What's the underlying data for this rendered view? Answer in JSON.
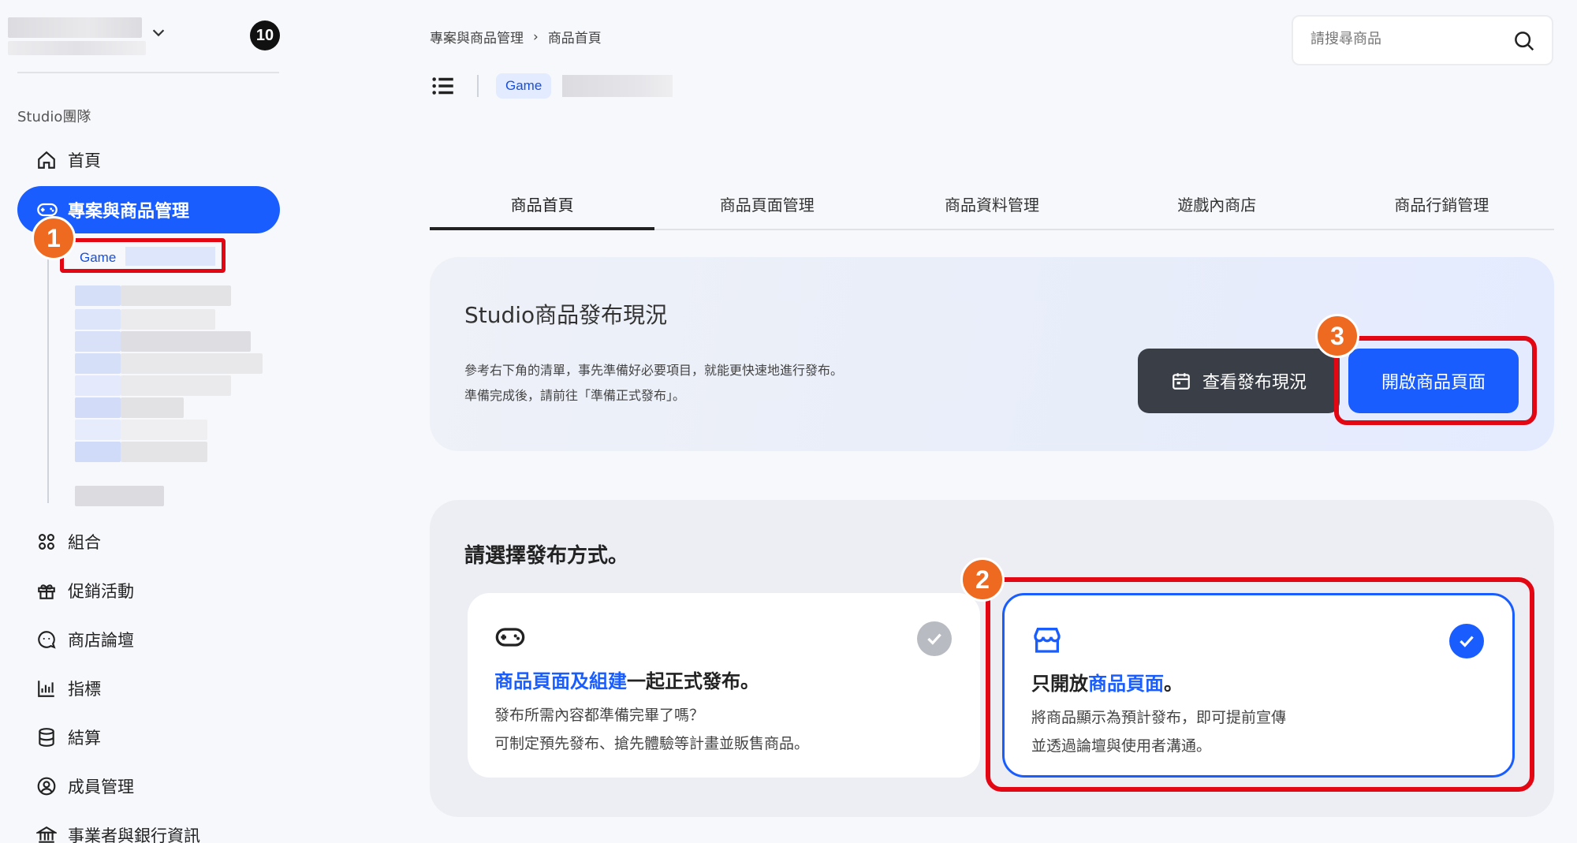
{
  "sidebar": {
    "notification_count": "10",
    "team_label": "Studio團隊",
    "home": "首頁",
    "active_item": "專案與商品管理",
    "game_label": "Game",
    "items": [
      "組合",
      "促銷活動",
      "商店論壇",
      "指標",
      "結算",
      "成員管理",
      "事業者與銀行資訊"
    ]
  },
  "breadcrumb": {
    "parent": "專案與商品管理",
    "separator": "›",
    "current": "商品首頁"
  },
  "search": {
    "placeholder": "請搜尋商品"
  },
  "header": {
    "chip": "Game"
  },
  "tabs": [
    "商品首頁",
    "商品頁面管理",
    "商品資料管理",
    "遊戲內商店",
    "商品行銷管理"
  ],
  "status_panel": {
    "title": "Studio商品發布現況",
    "desc_line1": "參考右下角的清單，事先準備好必要項目，就能更快速地進行發布。",
    "desc_line2": "準備完成後，請前往「準備正式發布」。",
    "status_button": "查看發布現況",
    "open_button": "開啟商品頁面"
  },
  "publish_panel": {
    "title": "請選擇發布方式。",
    "option1": {
      "title_highlight": "商品頁面及組建",
      "title_rest": "一起正式發布。",
      "desc_line1": "發布所需內容都準備完畢了嗎？",
      "desc_line2": "可制定預先發布、搶先體驗等計畫並販售商品。",
      "selected": false
    },
    "option2": {
      "title_prefix": "只開放",
      "title_highlight": "商品頁面",
      "title_rest": "。",
      "desc_line1": "將商品顯示為預計發布，即可提前宣傳",
      "desc_line2": "並透過論壇與使用者溝通。",
      "selected": true
    }
  },
  "step_badges": [
    "1",
    "2",
    "3"
  ],
  "colors": {
    "accent": "#1a5dff",
    "highlight_border": "#e30613",
    "badge": "#ee6a20",
    "dark_button": "#3a3f47"
  }
}
